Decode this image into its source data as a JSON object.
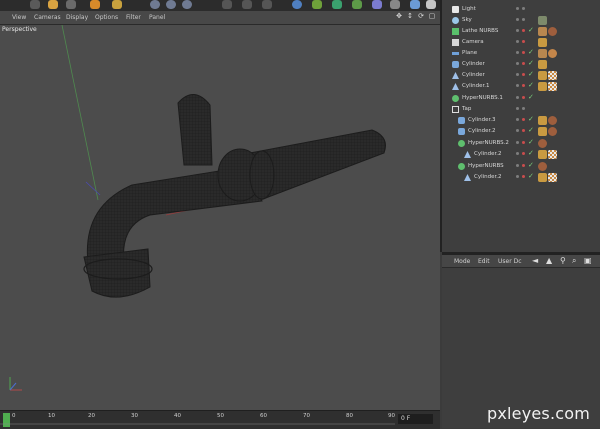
{
  "viewport_menu": [
    "View",
    "Cameras",
    "Display",
    "Options",
    "Filter",
    "Panel"
  ],
  "viewport_label": "Perspective",
  "timeline": {
    "ticks": [
      "0",
      "10",
      "20",
      "30",
      "40",
      "50",
      "60",
      "70",
      "80",
      "90"
    ],
    "frame": "0 F"
  },
  "object_manager": {
    "items": [
      {
        "name": "Light",
        "icon": "light-icon"
      },
      {
        "name": "Sky",
        "icon": "sky-icon"
      },
      {
        "name": "Lathe NURBS",
        "icon": "lathe-nurbs-icon"
      },
      {
        "name": "Camera",
        "icon": "camera-icon"
      },
      {
        "name": "Plane",
        "icon": "plane-icon"
      },
      {
        "name": "Cylinder",
        "icon": "cylinder-icon"
      },
      {
        "name": "Cylinder",
        "icon": "bend-icon"
      },
      {
        "name": "Cylinder.1",
        "icon": "bend-icon"
      },
      {
        "name": "HyperNURBS.1",
        "icon": "hypernurbs-icon"
      },
      {
        "name": "Tap",
        "icon": "null-icon"
      },
      {
        "name": "Cylinder.3",
        "icon": "cylinder-icon"
      },
      {
        "name": "Cylinder.2",
        "icon": "cylinder-icon"
      },
      {
        "name": "HyperNURBS.2",
        "icon": "hypernurbs-icon"
      },
      {
        "name": "Cylinder.2",
        "icon": "bend-icon"
      },
      {
        "name": "HyperNURBS",
        "icon": "hypernurbs-icon"
      },
      {
        "name": "Cylinder.2",
        "icon": "bend-icon"
      }
    ]
  },
  "attribute_manager": {
    "menu": [
      "Mode",
      "Edit",
      "User Dc"
    ]
  },
  "watermark": "pxleyes.com",
  "colors": {
    "accent_orange": "#e39a2a",
    "check_green": "#7cd07c",
    "viewport_bg": "#4c4c4c",
    "panel_bg": "#3e3e3e"
  }
}
